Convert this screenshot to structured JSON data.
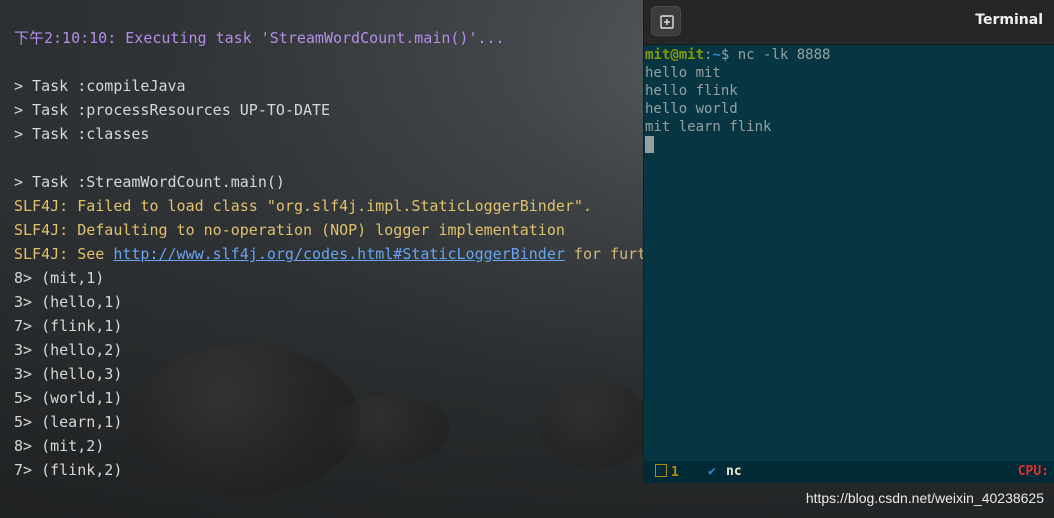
{
  "left_terminal": {
    "lines": [
      {
        "segments": [
          {
            "text": "下午2:10:10: Executing task 'StreamWordCount.main()'...",
            "class": "purple"
          }
        ]
      },
      {
        "segments": [
          {
            "text": "",
            "class": ""
          }
        ]
      },
      {
        "segments": [
          {
            "text": "> Task :compileJava",
            "class": ""
          }
        ]
      },
      {
        "segments": [
          {
            "text": "> Task :processResources UP-TO-DATE",
            "class": ""
          }
        ]
      },
      {
        "segments": [
          {
            "text": "> Task :classes",
            "class": ""
          }
        ]
      },
      {
        "segments": [
          {
            "text": "",
            "class": ""
          }
        ]
      },
      {
        "segments": [
          {
            "text": "> Task :StreamWordCount.main()",
            "class": ""
          }
        ]
      },
      {
        "segments": [
          {
            "text": "SLF4J: Failed to load class \"org.slf4j.impl.StaticLoggerBinder\".",
            "class": "yellow"
          }
        ]
      },
      {
        "segments": [
          {
            "text": "SLF4J: Defaulting to no-operation (NOP) logger implementation",
            "class": "yellow"
          }
        ]
      },
      {
        "segments": [
          {
            "text": "SLF4J: See ",
            "class": "yellow"
          },
          {
            "text": "http://www.slf4j.org/codes.html#StaticLoggerBinder",
            "class": "link"
          },
          {
            "text": " for furt",
            "class": "rest"
          }
        ]
      },
      {
        "segments": [
          {
            "text": "8> (mit,1)",
            "class": ""
          }
        ]
      },
      {
        "segments": [
          {
            "text": "3> (hello,1)",
            "class": ""
          }
        ]
      },
      {
        "segments": [
          {
            "text": "7> (flink,1)",
            "class": ""
          }
        ]
      },
      {
        "segments": [
          {
            "text": "3> (hello,2)",
            "class": ""
          }
        ]
      },
      {
        "segments": [
          {
            "text": "3> (hello,3)",
            "class": ""
          }
        ]
      },
      {
        "segments": [
          {
            "text": "5> (world,1)",
            "class": ""
          }
        ]
      },
      {
        "segments": [
          {
            "text": "5> (learn,1)",
            "class": ""
          }
        ]
      },
      {
        "segments": [
          {
            "text": "8> (mit,2)",
            "class": ""
          }
        ]
      },
      {
        "segments": [
          {
            "text": "7> (flink,2)",
            "class": ""
          }
        ]
      }
    ]
  },
  "right_terminal": {
    "title": "Terminal",
    "new_tab_icon": "new-tab-icon",
    "prompt": {
      "user": "mit@mit",
      "separator": ":",
      "path": "~",
      "symbol": "$",
      "command": " nc -lk 8888"
    },
    "output_lines": [
      "hello mit",
      "hello flink",
      "hello world",
      "mit learn flink"
    ],
    "status": {
      "window_index": "1",
      "check": "✔",
      "command": "nc",
      "cpu_label": "CPU:"
    }
  },
  "watermark": "https://blog.csdn.net/weixin_40238625"
}
